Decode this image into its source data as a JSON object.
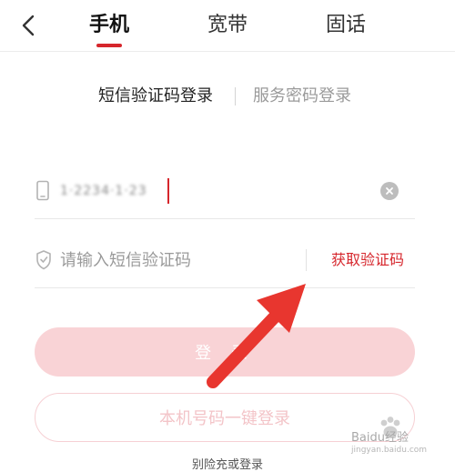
{
  "colors": {
    "accent": "#d6262c",
    "login_bg": "#f9d3d6",
    "onekey_text": "#f3c4c8",
    "arrow": "#e8362f"
  },
  "header": {
    "back_icon": "chevron-left-icon",
    "tabs": [
      {
        "label": "手机",
        "active": true
      },
      {
        "label": "宽带",
        "active": false
      },
      {
        "label": "固话",
        "active": false
      }
    ]
  },
  "login_modes": {
    "sms_label": "短信验证码登录",
    "password_label": "服务密码登录"
  },
  "phone_field": {
    "icon": "phone-icon",
    "value": "1·2234·1·23",
    "clear_icon": "clear-icon"
  },
  "sms_field": {
    "icon": "shield-icon",
    "placeholder": "请输入短信验证码",
    "get_code_label": "获取验证码"
  },
  "login_button": {
    "label": "登 录"
  },
  "onekey_button": {
    "label": "本机号码一键登录"
  },
  "bottom_link": {
    "label": "别险充或登录"
  },
  "watermark": {
    "brand": "Baidu经验",
    "domain": "jingyan.baidu.com"
  }
}
